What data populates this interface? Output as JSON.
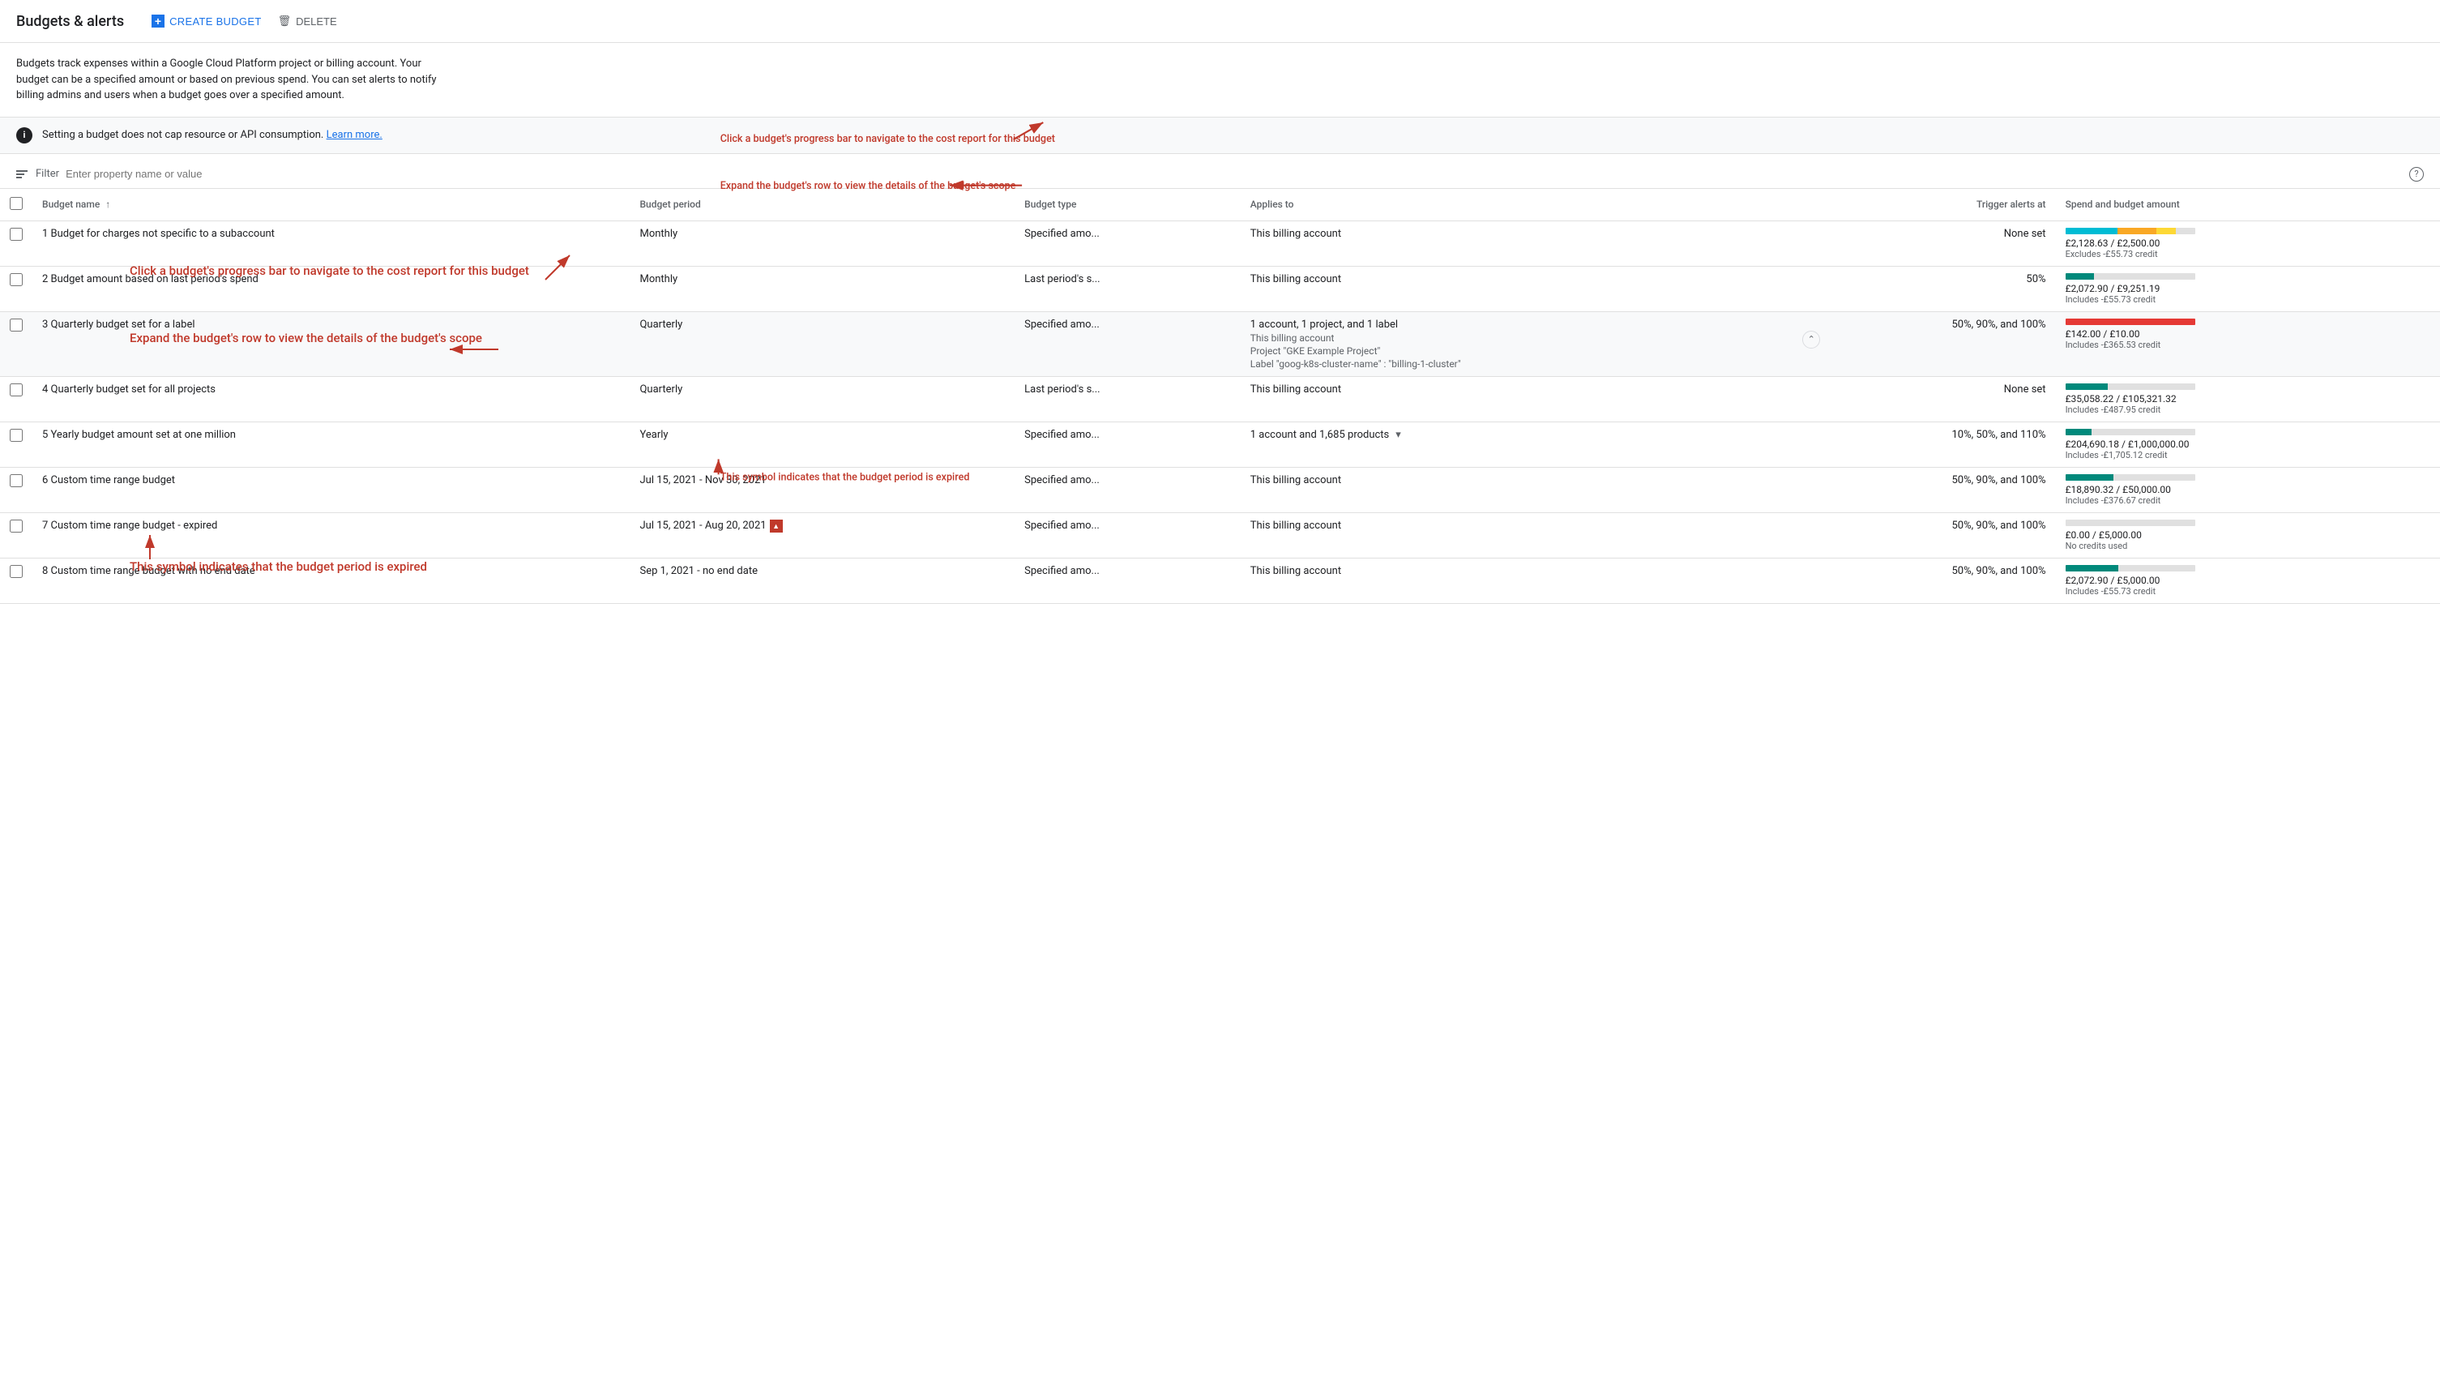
{
  "header": {
    "title": "Budgets & alerts",
    "create_button": "CREATE BUDGET",
    "delete_button": "DELETE"
  },
  "description": {
    "text": "Budgets track expenses within a Google Cloud Platform project or billing account. Your budget can be a specified amount or based on previous spend. You can set alerts to notify billing admins and users when a budget goes over a specified amount."
  },
  "info_banner": {
    "text": "Setting a budget does not cap resource or API consumption.",
    "learn_more": "Learn more."
  },
  "filter": {
    "label": "Filter",
    "placeholder": "Enter property name or value"
  },
  "table": {
    "columns": [
      "Budget name",
      "Budget period",
      "Budget type",
      "Applies to",
      "Trigger alerts at",
      "Spend and budget amount"
    ],
    "rows": [
      {
        "id": 1,
        "name": "1 Budget for charges not specific to a subaccount",
        "period": "Monthly",
        "type": "Specified amo...",
        "applies_to": "This billing account",
        "trigger": "None set",
        "amount": "£2,128.63 / £2,500.00",
        "credit": "Excludes -£55.73 credit",
        "bar": [
          {
            "color": "#00bcd4",
            "pct": 40
          },
          {
            "color": "#f9a825",
            "pct": 30
          },
          {
            "color": "#fdd835",
            "pct": 15
          }
        ],
        "expanded": false,
        "expired": false
      },
      {
        "id": 2,
        "name": "2 Budget amount based on last period's spend",
        "period": "Monthly",
        "type": "Last period's s...",
        "applies_to": "This billing account",
        "trigger": "50%",
        "amount": "£2,072.90 / £9,251.19",
        "credit": "Includes -£55.73 credit",
        "bar": [
          {
            "color": "#00897b",
            "pct": 22
          },
          {
            "color": "#e0e0e0",
            "pct": 78
          }
        ],
        "expanded": false,
        "expired": false
      },
      {
        "id": 3,
        "name": "3 Quarterly budget set for a label",
        "period": "Quarterly",
        "type": "Specified amo...",
        "applies_to": "1 account, 1 project, and 1 label",
        "applies_sub": [
          "This billing account",
          "Project \"GKE Example Project\"",
          "Label \"goog-k8s-cluster-name\" : \"billing-1-cluster\""
        ],
        "trigger": "50%, 90%, and 100%",
        "amount": "£142.00 / £10.00",
        "credit": "Includes -£365.53 credit",
        "bar": [
          {
            "color": "#e53935",
            "pct": 100
          }
        ],
        "expanded": true,
        "expired": false
      },
      {
        "id": 4,
        "name": "4 Quarterly budget set for all projects",
        "period": "Quarterly",
        "type": "Last period's s...",
        "applies_to": "This billing account",
        "trigger": "None set",
        "amount": "£35,058.22 / £105,321.32",
        "credit": "Includes -£487.95 credit",
        "bar": [
          {
            "color": "#00897b",
            "pct": 33
          },
          {
            "color": "#e0e0e0",
            "pct": 67
          }
        ],
        "expanded": false,
        "expired": false
      },
      {
        "id": 5,
        "name": "5 Yearly budget amount set at one million",
        "period": "Yearly",
        "type": "Specified amo...",
        "applies_to": "1 account and 1,685 products",
        "trigger": "10%, 50%, and 110%",
        "amount": "£204,690.18 / £1,000,000.00",
        "credit": "Includes -£1,705.12 credit",
        "bar": [
          {
            "color": "#00897b",
            "pct": 20
          },
          {
            "color": "#e0e0e0",
            "pct": 80
          }
        ],
        "expanded": false,
        "expired": false,
        "has_expand": true
      },
      {
        "id": 6,
        "name": "6 Custom time range budget",
        "period": "Jul 15, 2021 - Nov 30, 2021",
        "type": "Specified amo...",
        "applies_to": "This billing account",
        "trigger": "50%, 90%, and 100%",
        "amount": "£18,890.32 / £50,000.00",
        "credit": "Includes -£376.67 credit",
        "bar": [
          {
            "color": "#00897b",
            "pct": 37
          },
          {
            "color": "#e0e0e0",
            "pct": 63
          }
        ],
        "expanded": false,
        "expired": false
      },
      {
        "id": 7,
        "name": "7 Custom time range budget - expired",
        "period": "Jul 15, 2021 - Aug 20, 2021",
        "type": "Specified amo...",
        "applies_to": "This billing account",
        "trigger": "50%, 90%, and 100%",
        "amount": "£0.00 / £5,000.00",
        "credit": "No credits used",
        "bar": [
          {
            "color": "#e0e0e0",
            "pct": 100
          }
        ],
        "expanded": false,
        "expired": true
      },
      {
        "id": 8,
        "name": "8 Custom time range budget with no end date",
        "period": "Sep 1, 2021 - no end date",
        "type": "Specified amo...",
        "applies_to": "This billing account",
        "trigger": "50%, 90%, and 100%",
        "amount": "£2,072.90 / £5,000.00",
        "credit": "Includes -£55.73 credit",
        "bar": [
          {
            "color": "#00897b",
            "pct": 41
          },
          {
            "color": "#e0e0e0",
            "pct": 59
          }
        ],
        "expanded": false,
        "expired": false
      }
    ]
  },
  "annotations": {
    "arrow1_text": "Click a budget's progress bar to navigate to the cost report for this budget",
    "arrow2_text": "Expand the budget's row to view the details of the budget's scope",
    "arrow3_text": "This symbol indicates that the budget period is expired"
  }
}
